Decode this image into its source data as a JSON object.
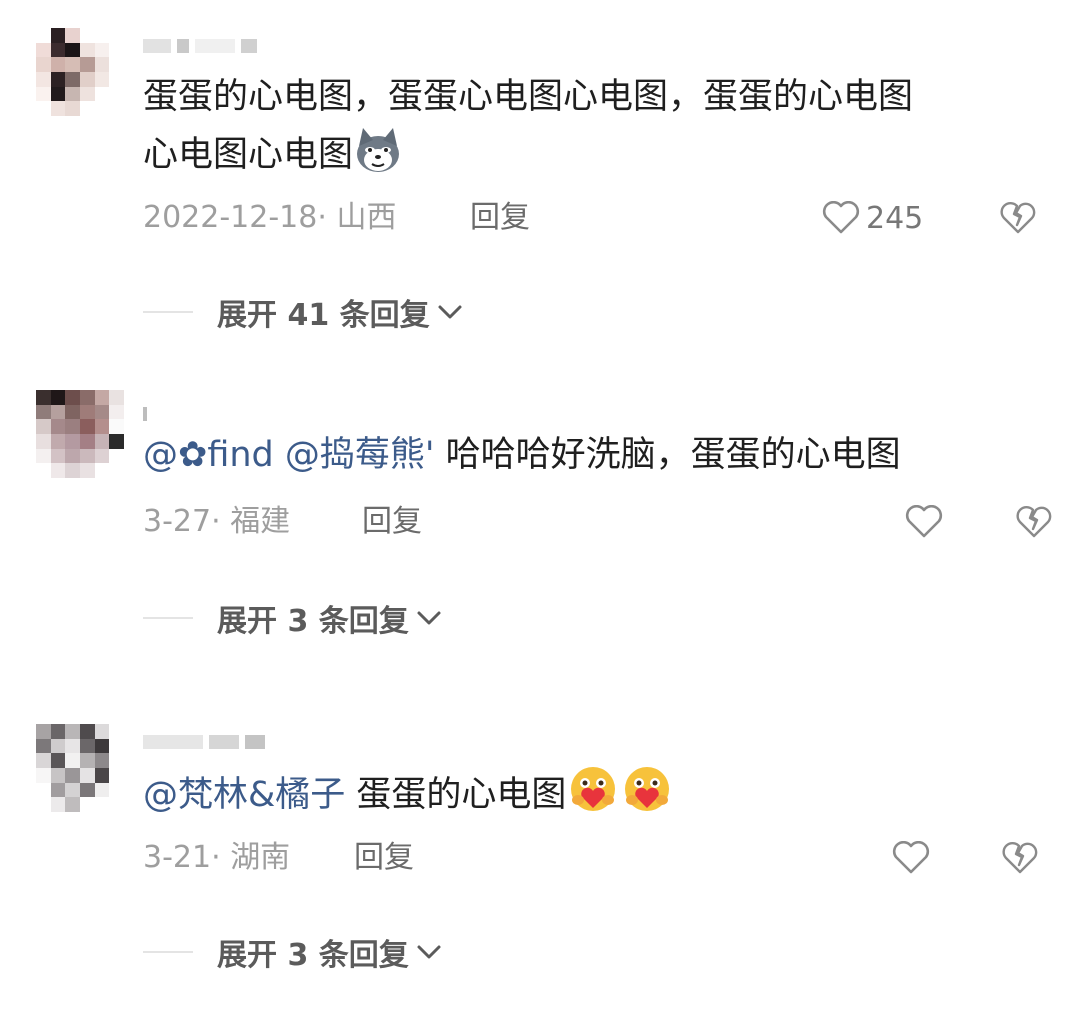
{
  "comments": [
    {
      "text_parts": [
        "蛋蛋的心电图，蛋蛋心电图心电图，蛋蛋的心电图",
        "心电图心电图"
      ],
      "emoji": "dog-emoji",
      "date": "2022-12-18",
      "sep": "·",
      "location": "山西",
      "reply_label": "回复",
      "likes": "245",
      "expand_label": "展开 41 条回复"
    },
    {
      "mention": "@✿find @捣莓熊'",
      "text": " 哈哈哈好洗脑，蛋蛋的心电图",
      "date": "3-27",
      "sep": "·",
      "location": "福建",
      "reply_label": "回复",
      "expand_label": "展开 3 条回复"
    },
    {
      "mention": "@梵林&橘子",
      "text": " 蛋蛋的心电图",
      "emoji": "hug-emoji",
      "date": "3-21",
      "sep": "·",
      "location": "湖南",
      "reply_label": "回复",
      "expand_label": "展开 3 条回复"
    }
  ],
  "colors": {
    "mention": "#3c5b8a",
    "meta": "#9e9e9e",
    "icon": "#8a8a8a"
  }
}
